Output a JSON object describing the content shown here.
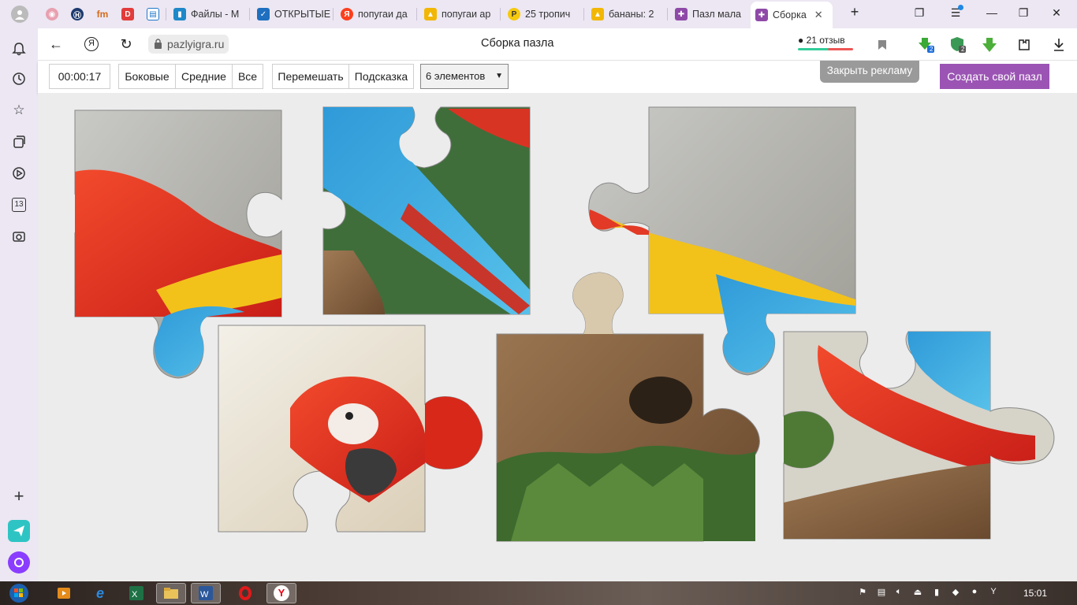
{
  "browser": {
    "tabs": [
      {
        "label": "",
        "icon": "opera-icon"
      },
      {
        "label": "",
        "icon": "hse-icon"
      },
      {
        "label": "",
        "icon": "fm-icon"
      },
      {
        "label": "",
        "icon": "d-icon"
      },
      {
        "label": "",
        "icon": "book-icon"
      },
      {
        "label": "Файлы - М",
        "icon": "files-icon"
      },
      {
        "label": "ОТКРЫТЫЕ",
        "icon": "check-icon"
      },
      {
        "label": "попугаи да",
        "icon": "yandex-icon"
      },
      {
        "label": "попугаи ар",
        "icon": "image-icon"
      },
      {
        "label": "25 тропич",
        "icon": "p-icon"
      },
      {
        "label": "бананы: 2",
        "icon": "image-icon"
      },
      {
        "label": "Пазл мала",
        "icon": "puzzle-icon"
      },
      {
        "label": "Сборка",
        "icon": "puzzle-icon"
      }
    ],
    "url": "pazlyigra.ru",
    "page_title": "Сборка пазла",
    "reviews": "21 отзыв",
    "badge_counts": [
      "2",
      "2"
    ],
    "side_badge": "13"
  },
  "game": {
    "timer": "00:00:17",
    "filter_side": "Боковые",
    "filter_middle": "Средние",
    "filter_all": "Все",
    "shuffle": "Перемешать",
    "hint": "Подсказка",
    "pieces_selected": "6 элементов",
    "close_ad": "Закрыть рекламу",
    "create_puzzle": "Создать свой пазл",
    "pieces_count": 6
  },
  "taskbar": {
    "clock": "15:01"
  },
  "colors": {
    "accent": "#9b54b4",
    "tab_bg": "#ece7f3",
    "board_bg": "#ececec"
  }
}
